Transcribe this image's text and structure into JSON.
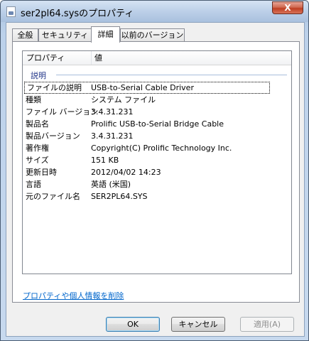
{
  "window": {
    "title": "ser2pl64.sysのプロパティ",
    "close_label": "X"
  },
  "tabs": [
    {
      "label": "全般"
    },
    {
      "label": "セキュリティ"
    },
    {
      "label": "詳細"
    },
    {
      "label": "以前のバージョン"
    }
  ],
  "active_tab": "詳細",
  "list": {
    "columns": {
      "property": "プロパティ",
      "value": "値"
    },
    "group": "説明",
    "rows": [
      {
        "name": "ファイルの説明",
        "value": "USB-to-Serial Cable Driver"
      },
      {
        "name": "種類",
        "value": "システム ファイル"
      },
      {
        "name": "ファイル バージョン",
        "value": "3.4.31.231"
      },
      {
        "name": "製品名",
        "value": "Prolific USB-to-Serial Bridge Cable"
      },
      {
        "name": "製品バージョン",
        "value": "3.4.31.231"
      },
      {
        "name": "著作権",
        "value": "Copyright(C) Prolific Technology Inc."
      },
      {
        "name": "サイズ",
        "value": "151 KB"
      },
      {
        "name": "更新日時",
        "value": "2012/04/02 14:23"
      },
      {
        "name": "言語",
        "value": "英語 (米国)"
      },
      {
        "name": "元のファイル名",
        "value": "SER2PL64.SYS"
      }
    ]
  },
  "footer": {
    "remove_link": "プロパティや個人情報を削除"
  },
  "buttons": {
    "ok": "OK",
    "cancel": "キャンセル",
    "apply": "適用(A)"
  }
}
